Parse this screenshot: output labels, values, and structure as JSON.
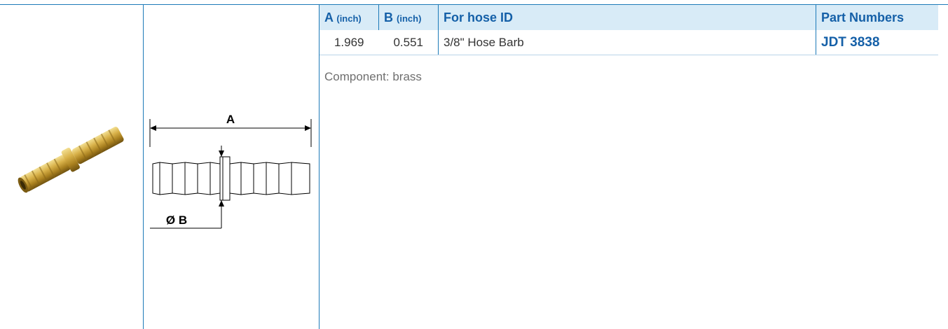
{
  "table": {
    "headers": {
      "a": {
        "letter": "A",
        "unit": "(inch)"
      },
      "b": {
        "letter": "B",
        "unit": "(inch)"
      },
      "hose": "For hose ID",
      "part": "Part Numbers"
    },
    "rows": [
      {
        "a": "1.969",
        "b": "0.551",
        "hose": "3/8\" Hose Barb",
        "part": "JDT 3838"
      }
    ]
  },
  "note": "Component: brass",
  "drawing": {
    "label_a": "A",
    "label_b": "Ø B"
  },
  "colors": {
    "accent": "#1560a8",
    "header_bg": "#d8ebf7",
    "rule": "#1d7ab8",
    "brass": "#c9a13a"
  }
}
